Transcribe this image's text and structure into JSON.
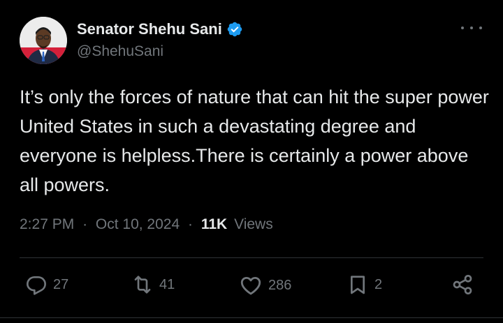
{
  "author": {
    "display_name": "Senator Shehu Sani",
    "handle": "@ShehuSani",
    "verified": true
  },
  "tweet": {
    "text": "It’s only the forces of nature that can hit the super power United States in such a devastating degree and everyone is helpless.There is certainly a power above all powers.",
    "time": "2:27 PM",
    "separator": "·",
    "date": "Oct 10, 2024",
    "views_count": "11K",
    "views_label": "Views"
  },
  "actions": {
    "replies": "27",
    "reposts": "41",
    "likes": "286",
    "bookmarks": "2"
  },
  "colors": {
    "background": "#000000",
    "text": "#e7e9ea",
    "muted": "#71767b",
    "verified": "#1d9bf0",
    "divider": "#2f3336"
  },
  "icons": {
    "more": "more-dots-icon",
    "reply": "reply-icon",
    "repost": "repost-icon",
    "like": "heart-icon",
    "bookmark": "bookmark-icon",
    "share": "share-icon",
    "verified": "verified-badge-icon"
  }
}
